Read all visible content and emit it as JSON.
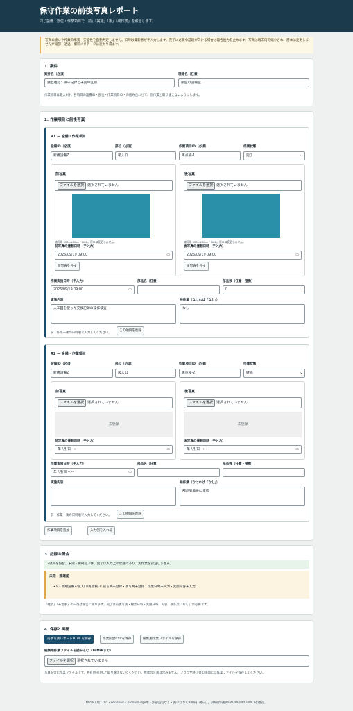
{
  "header": {
    "title": "保守作業の前後写真レポート",
    "subtitle": "同じ設備・部位・作業項目で「前」「実施」「後」「残作業」を照合します。"
  },
  "notice": "写真の違いや作業の事実・安全性を自動判定しません。日時は撮影者が手入力します。完了に必要な証跡が欠ける場合は報告出力を止めます。写真は端末内で縮小され、原本は変更しませんが縮部・透過・撮影メタデータは変わり得ます。",
  "case": {
    "heading": "1. 案件",
    "name_label": "案件名（必須）",
    "name_value": "独立確認：保守記録と未完の区別",
    "site_label": "現場名（任意）",
    "site_value": "架空の設備室",
    "note": "作業項目は最大8件。各項目の設備ID・部位・作業項目ID・の組み合わせで、別作業と取り違えないようにします。"
  },
  "items_section": {
    "heading": "2. 作業項目と前後写真",
    "add_button": "作業項目を追加",
    "sample_button": "入力例を入れる"
  },
  "items": [
    {
      "title": "R1 — 設備・作業項目",
      "equip_label": "設備ID（必須）",
      "equip_value": "新規設備Z",
      "part_label": "部位（必須）",
      "part_value": "吸入口",
      "task_label": "作業項目ID（必須）",
      "task_value": "再点検-1",
      "status_label": "作業状態",
      "status_value": "完了",
      "before": {
        "title": "前写真",
        "file_button": "ファイルを選択",
        "file_text": "選択されていません",
        "image_note": "縮写用 320×180px / 1KiB。原本は変更しません。",
        "date_label": "前写真の撮影日時（手入力）",
        "date_value": "2026/09/19 09:00",
        "remove_button": "前写真を外す"
      },
      "after": {
        "title": "後写真",
        "file_button": "ファイルを選択",
        "file_text": "選択されていません",
        "image_note": "縮写用 320×180px / 1KiB。原本は変更しません。",
        "date_label": "後写真の撮影日時（手入力）",
        "date_value": "2026/09/19 09:00",
        "remove_button": "後写真を外す"
      },
      "work_date_label": "作業実施日時（手入力）",
      "work_date_value": "2026/09/19 09:00",
      "parts_name_label": "部品名（任意）",
      "parts_name_value": "",
      "parts_count_label": "部品数（任意・整数）",
      "parts_count_value": "0",
      "content_label": "実施内容",
      "content_value": "人工図を使った交換記録の操作検査",
      "remain_label": "残作業（なければ「なし」）",
      "remain_value": "なし",
      "footer_note": "前・作業一後の日時順で入力してください。",
      "delete_button": "この項目を削除"
    },
    {
      "title": "R2 — 設備・作業項目",
      "equip_label": "設備ID（必須）",
      "equip_value": "新規設備Z",
      "part_label": "部位（必須）",
      "part_value": "吸入口",
      "task_label": "作業項目ID（必須）",
      "task_value": "再点検-2",
      "status_label": "作業状態",
      "status_value": "継続",
      "before": {
        "title": "前写真",
        "file_button": "ファイルを選択",
        "file_text": "選択されていません",
        "empty_text": "未登録",
        "date_label": "前写真の撮影日時（手入力）",
        "date_value": "年 /月/日  --:--"
      },
      "after": {
        "title": "後写真",
        "file_button": "ファイルを選択",
        "file_text": "選択されていません",
        "empty_text": "未登録",
        "date_label": "後写真の撮影日時（手入力）",
        "date_value": "年 /月/日  --:--"
      },
      "work_date_label": "作業実施日時（手入力）",
      "work_date_value": "年 /月/日  --:--",
      "parts_name_label": "部品名（任意）",
      "parts_name_value": "",
      "parts_count_label": "部品数（任意・整数）",
      "parts_count_value": "",
      "content_label": "実施内容",
      "content_value": "",
      "remain_label": "残作業（なければ「なし」）",
      "remain_value": "部品到着後に確認",
      "footer_note": "前・作業一後の日時順で入力してください。",
      "delete_button": "この項目を削除"
    }
  ],
  "check": {
    "heading": "3. 記録の照合",
    "summary": "2項目を照合。未完・要確認 1件。完了は入力上の状態であり、実作業を認証しません。",
    "warn_title": "未完・要確認",
    "warn_item": "R2 新規設備Z/吸入口/再点検-2: 前写真未登録・後写真未登録・作業日時未入力・実施内容未入力",
    "note": "「継続」「未着手」の欠落は報告に残ります。完了は前後写真・撮影日時・実施日時・内容・残作業「なし」が必要です。"
  },
  "save": {
    "heading": "4. 保存と再開",
    "btn_report": "前後写真レポートHTMLを保存",
    "btn_csv": "作業照合CSVを保存",
    "btn_edit": "編集用作業ファイルを保存",
    "load_label": "編集用作業ファイルを読み込む（16MiBまで）",
    "file_button": "ファイルを選択",
    "file_text": "選択されていません",
    "note": "写真を含む作業ファイルです。共有用HTMLと取り違えないでください。原本の写真は含みません。ブラウザ終了後の再開には作業ファイルを保存してください。"
  },
  "footer": "N056 / 版1.0.0・Windows Chrome/Edge用・外部送信なし・買い切り1,980円（税込）。詳細は同梱README/PRODUCTを確認。"
}
